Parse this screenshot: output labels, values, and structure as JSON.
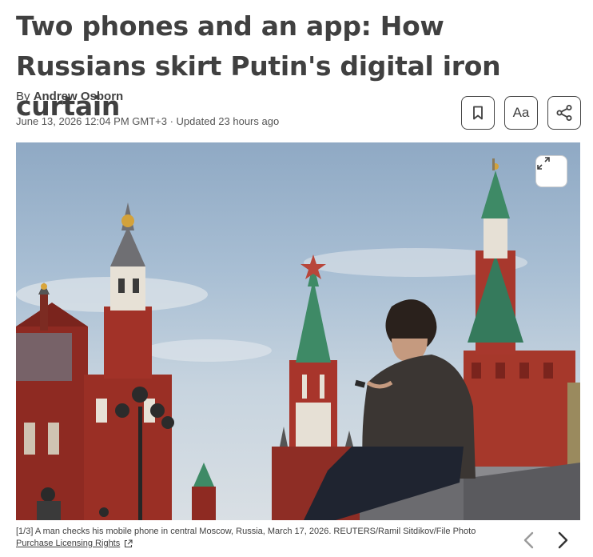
{
  "article": {
    "headline": "Two phones and an app: How Russians skirt Putin's digital iron curtain",
    "by_prefix": "By ",
    "author": "Andrew Osborn",
    "dateline": "June 13, 2026 12:04 PM GMT+3 · Updated 23 hours ago"
  },
  "toolbar": {
    "bookmark_icon": "bookmark-icon",
    "font_label": "Aa",
    "share_icon": "share-icon"
  },
  "image": {
    "expand_icon": "expand-icon",
    "caption": "[1/3] A man checks his mobile phone in central Moscow, Russia, March 17, 2026. REUTERS/Ramil Sitdikov/File Photo",
    "licensing_label": "Purchase Licensing Rights",
    "external_link_icon": "external-link-icon",
    "prev_icon": "chevron-left-icon",
    "next_icon": "chevron-right-icon"
  }
}
